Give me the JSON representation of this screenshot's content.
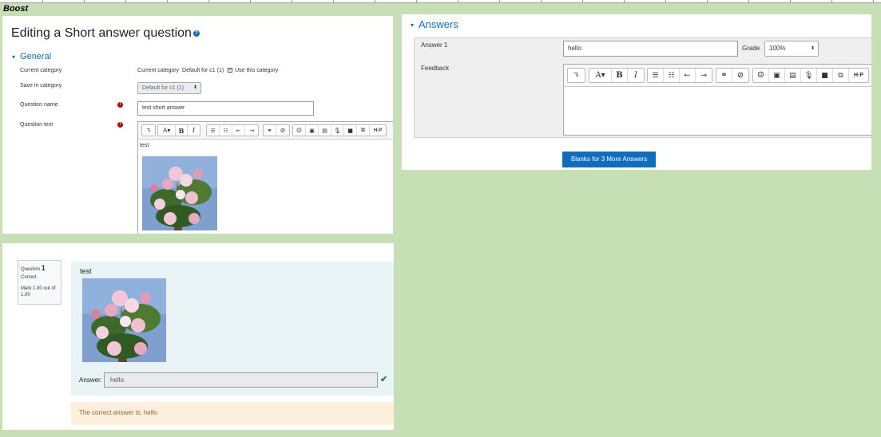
{
  "sheet_label": "Boost",
  "edit_panel": {
    "title": "Editing a Short answer question",
    "general_section": "General",
    "labels": {
      "current_category": "Current category",
      "save_in_category": "Save in category",
      "question_name": "Question name",
      "question_text": "Question text"
    },
    "current_category_prefix": "Current category",
    "current_category_value": "Default for c1 (1)",
    "use_this_category": "Use this category",
    "save_in_category_value": "Default for c1 (1)",
    "question_name_value": "test short answer",
    "question_text_value": "test"
  },
  "answers_panel": {
    "title": "Answers",
    "answer1_label": "Answer 1",
    "answer1_value": "hello",
    "grade_label": "Grade",
    "grade_value": "100%",
    "feedback_label": "Feedback",
    "blanks_button": "Blanks for 3 More Answers"
  },
  "preview_panel": {
    "question_word": "Question",
    "question_number": "1",
    "state": "Correct",
    "mark": "Mark 1.00 out of 1.00",
    "question_text": "test",
    "answer_label": "Answer:",
    "answer_value": "hello",
    "correct_answer_text": "The correct answer is: hello"
  },
  "icons": {
    "toolbar": [
      "undo-icon",
      "font-color-icon",
      "bold-icon",
      "italic-icon",
      "bullet-list-icon",
      "numbered-list-icon",
      "outdent-icon",
      "indent-icon",
      "link-icon",
      "unlink-icon",
      "emoji-icon",
      "image-icon",
      "media-icon",
      "record-audio-icon",
      "record-video-icon",
      "manage-files-icon",
      "h5p-icon"
    ],
    "check": "check-icon",
    "help": "help-icon",
    "required": "required-icon"
  },
  "colors": {
    "background": "#c6dfb4",
    "accent": "#0f6cbf",
    "correct_bg": "#e7f3f5",
    "feedback_bg": "#fcefdc"
  }
}
